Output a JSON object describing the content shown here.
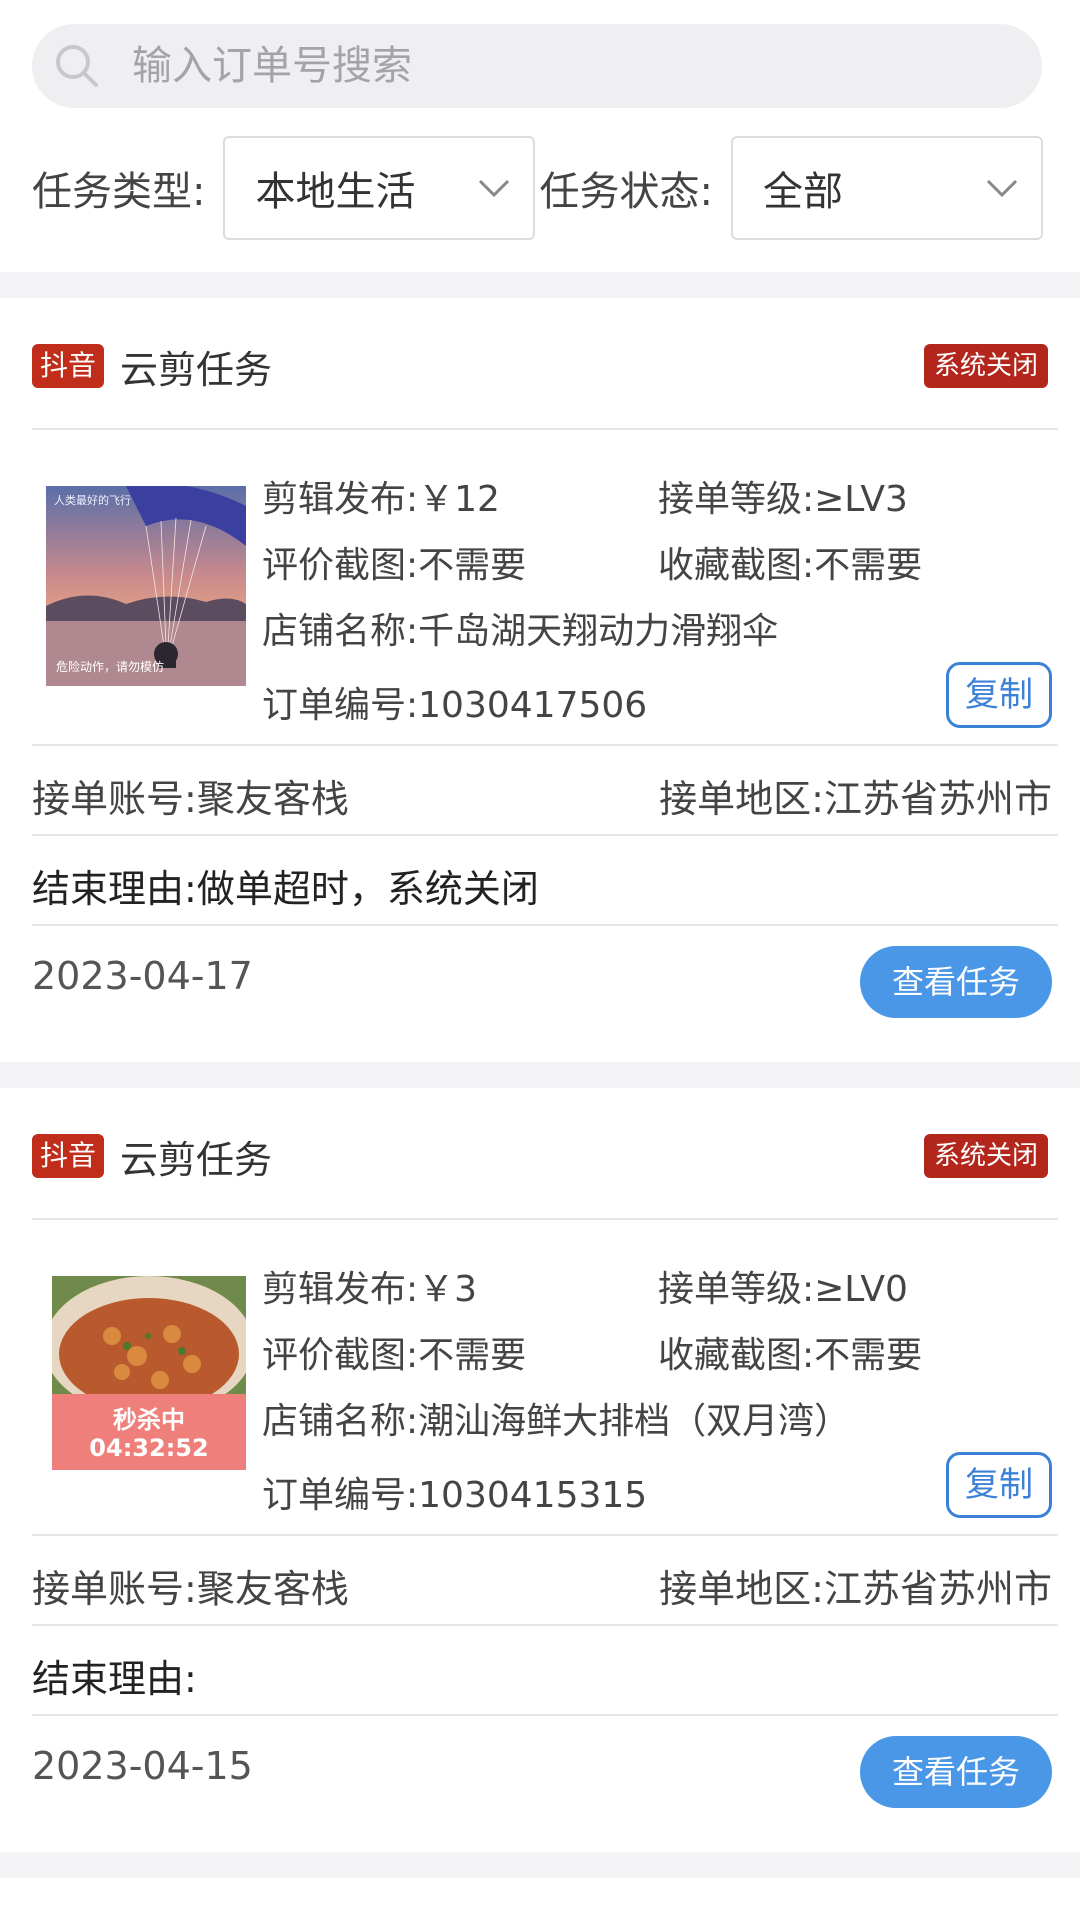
{
  "search": {
    "placeholder": "输入订单号搜索",
    "value": ""
  },
  "filters": {
    "type_label": "任务类型:",
    "type_value": "本地生活",
    "status_label": "任务状态:",
    "status_value": "全部"
  },
  "labels": {
    "edit_publish": "剪辑发布:",
    "level": "接单等级:",
    "review_shot": "评价截图:",
    "fav_shot": "收藏截图:",
    "shop": "店铺名称:",
    "order_no": "订单编号:",
    "account": "接单账号:",
    "region": "接单地区:",
    "reason": "结束理由:",
    "copy": "复制",
    "view": "查看任务"
  },
  "orders": [
    {
      "platform": "抖音",
      "title": "云剪任务",
      "status": "系统关闭",
      "price": "￥12",
      "level": "≥LV3",
      "review_shot": "不需要",
      "fav_shot": "不需要",
      "shop": "千岛湖天翔动力滑翔伞",
      "order_no": "1030417506",
      "account": "聚友客栈",
      "region": "江苏省苏州市",
      "reason": "做单超时，系统关闭",
      "date": "2023-04-17",
      "thumb_overlay": "危险动作，请勿模仿",
      "thumb_caption": "人类最好的飞行"
    },
    {
      "platform": "抖音",
      "title": "云剪任务",
      "status": "系统关闭",
      "price": "￥3",
      "level": "≥LV0",
      "review_shot": "不需要",
      "fav_shot": "不需要",
      "shop": "潮汕海鲜大排档（双月湾）",
      "order_no": "1030415315",
      "account": "聚友客栈",
      "region": "江苏省苏州市",
      "reason": "",
      "date": "2023-04-15",
      "thumb_overlay": "秒杀中",
      "thumb_timer": "04:32:52"
    }
  ],
  "colors": {
    "accent_blue": "#4a97e8",
    "tag_red": "#c12d1b",
    "status_red": "#b3261c"
  }
}
